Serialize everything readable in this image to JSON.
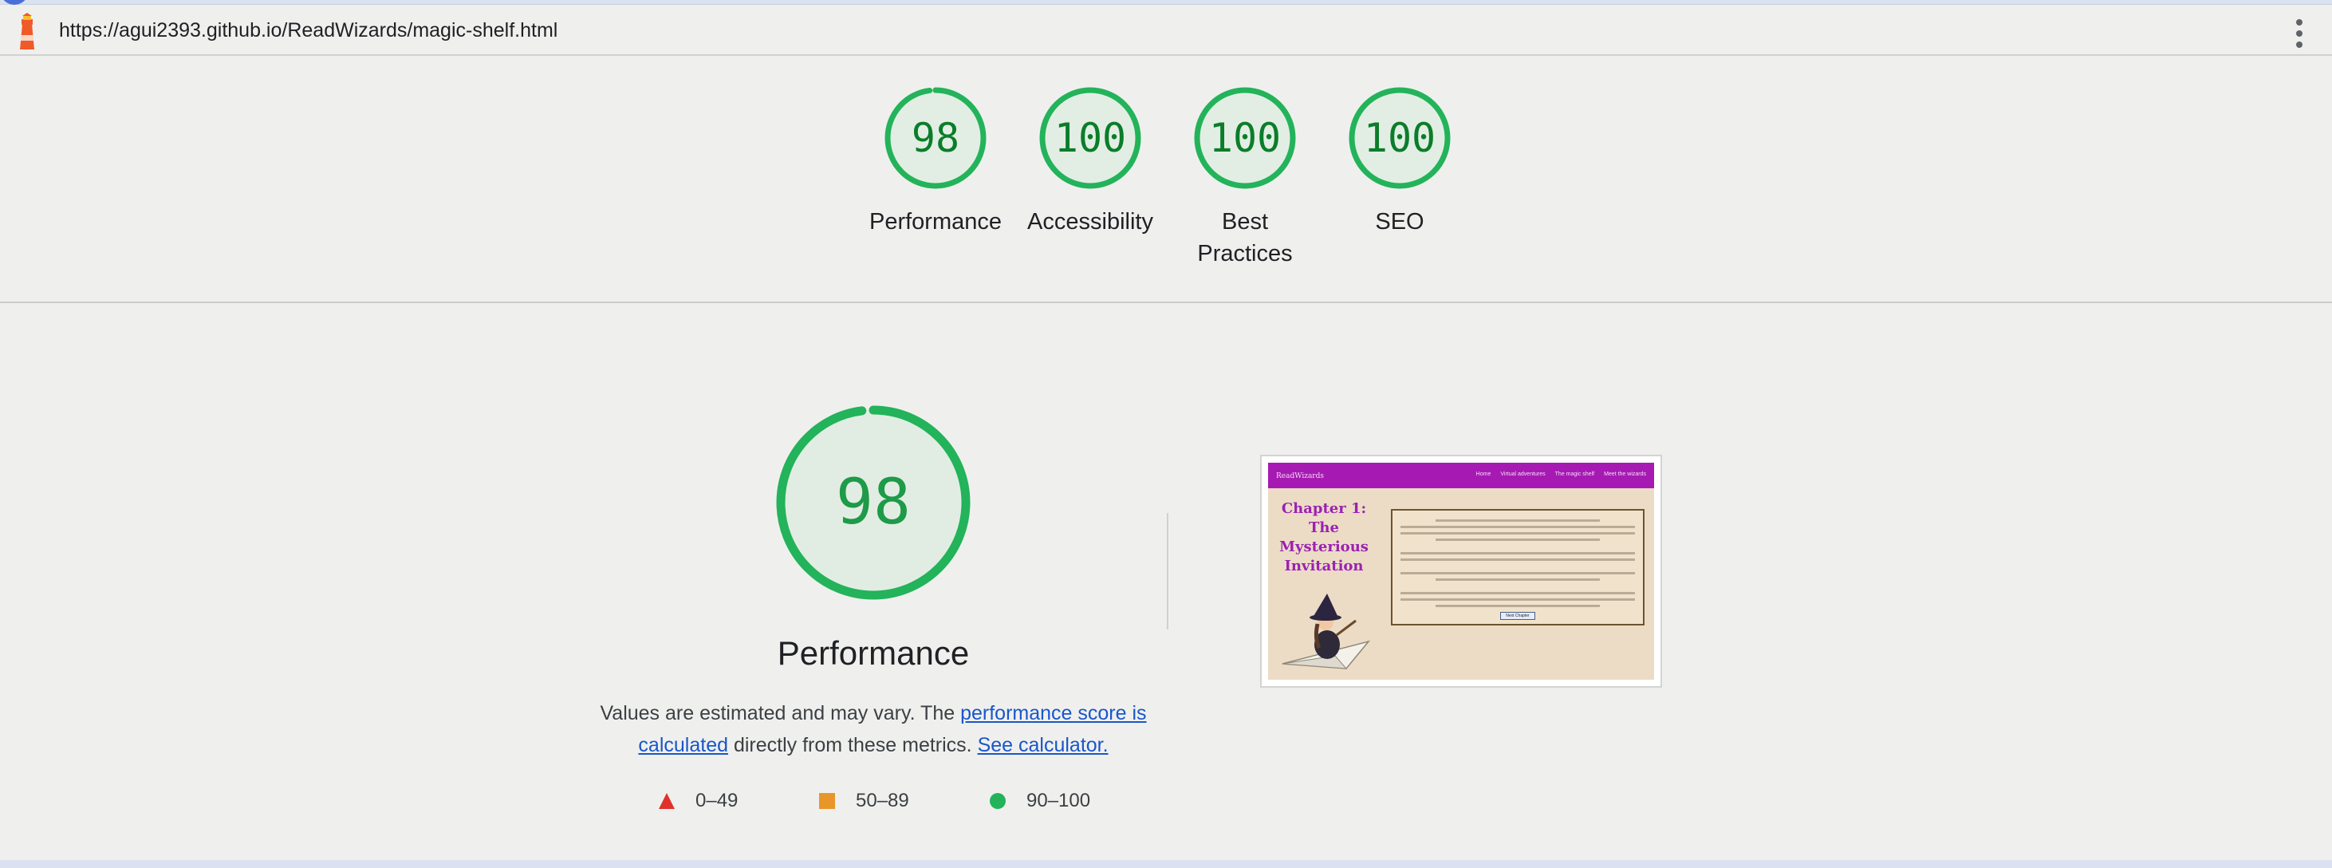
{
  "browser": {
    "url": "https://agui2393.github.io/ReadWizards/magic-shelf.html",
    "logo_icon": "lighthouse-icon",
    "menu_icon": "kebab-menu-icon"
  },
  "scores": [
    {
      "label": "Performance",
      "value": "98",
      "fraction": 0.98
    },
    {
      "label": "Accessibility",
      "value": "100",
      "fraction": 1.0
    },
    {
      "label": "Best Practices",
      "value": "100",
      "fraction": 1.0
    },
    {
      "label": "SEO",
      "value": "100",
      "fraction": 1.0
    }
  ],
  "performance": {
    "score": "98",
    "fraction": 0.98,
    "title": "Performance",
    "desc_prefix": "Values are estimated and may vary. The ",
    "desc_link1": "performance score is calculated",
    "desc_middle": " directly from these metrics. ",
    "desc_link2": "See calculator."
  },
  "legend": [
    {
      "shape": "triangle",
      "range": "0–49",
      "color": "#e0312d"
    },
    {
      "shape": "square",
      "range": "50–89",
      "color": "#e8952a"
    },
    {
      "shape": "circle",
      "range": "90–100",
      "color": "#23b35a"
    }
  ],
  "screenshot": {
    "site_logo": "ReadWizards",
    "nav_links": [
      "Home",
      "Virtual adventures",
      "The magic shelf",
      "Meet the wizards"
    ],
    "chapter_title": "Chapter 1: The Mysterious Invitation",
    "button_label": "Next Chapter"
  },
  "colors": {
    "pass": "#23b35a",
    "pass_text": "#0b7d2a",
    "site_nav": "#a61ab3",
    "chapter": "#9b22b2"
  }
}
